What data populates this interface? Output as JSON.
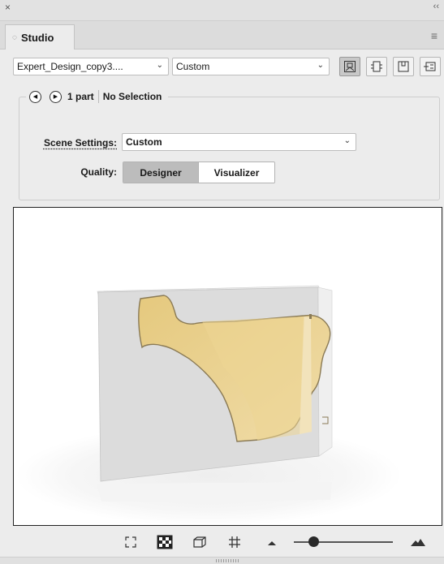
{
  "window": {
    "close_glyph": "×",
    "collapse_glyph": "‹‹"
  },
  "tab": {
    "icon": "◌",
    "label": "Studio"
  },
  "panel_menu_glyph": "≡",
  "toolbar": {
    "file_select": "Expert_Design_copy3....",
    "preset_select": "Custom",
    "view_buttons": [
      "scene-view-icon",
      "front-view-icon",
      "top-view-icon",
      "side-view-icon"
    ],
    "active_view": 0
  },
  "navigation": {
    "prev_glyph": "◀",
    "next_glyph": "▶",
    "part_count": "1 part",
    "selection": "No Selection"
  },
  "scene_settings": {
    "label": "Scene Settings:",
    "value": "Custom"
  },
  "quality": {
    "label": "Quality:",
    "options": [
      "Designer",
      "Visualizer"
    ],
    "selected": "Designer"
  },
  "colors": {
    "cutout": "#e8d08c",
    "box": "#dedede",
    "selected_segment": "#bcbcbc"
  },
  "bottom_tools": [
    "fit-view-icon",
    "checkerboard-icon",
    "cube-icon",
    "grid-icon",
    "zoom-out-mountain-icon",
    "zoom-slider",
    "zoom-in-mountain-icon"
  ],
  "zoom_level": 0.2
}
